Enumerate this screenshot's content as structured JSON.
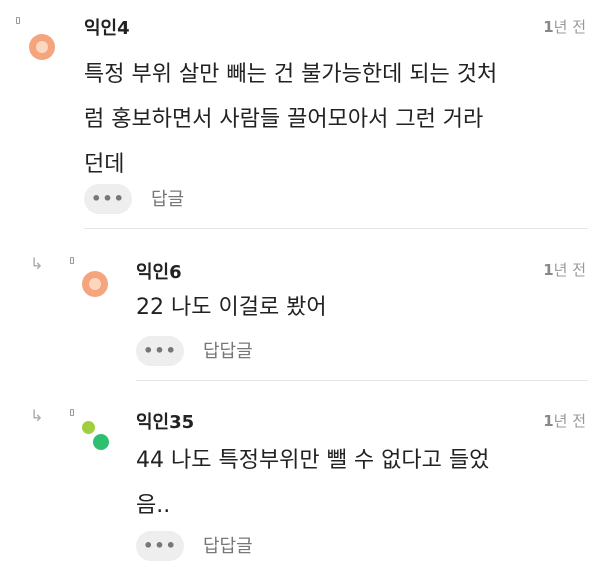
{
  "comments": [
    {
      "author": "익인4",
      "time_num": "1",
      "time_unit": "년 전",
      "lines": [
        "특정 부위 살만 빼는 건 불가능한데 되는 것처",
        "럼 홍보하면서 사람들 끌어모아서 그런 거라",
        "던데"
      ],
      "more": "•••",
      "reply": "답글"
    },
    {
      "author": "익인6",
      "time_num": "1",
      "time_unit": "년 전",
      "lines": [
        "22 나도 이걸로 봤어"
      ],
      "more": "•••",
      "reply": "답답글"
    },
    {
      "author": "익인35",
      "time_num": "1",
      "time_unit": "년 전",
      "lines": [
        "44 나도 특정부위만 뺄 수 없다고 들었",
        "음.."
      ],
      "more": "•••",
      "reply": "답답글"
    }
  ],
  "icons": {
    "reply_arrow": "reply-arrow-icon",
    "marker": "marker-icon"
  }
}
